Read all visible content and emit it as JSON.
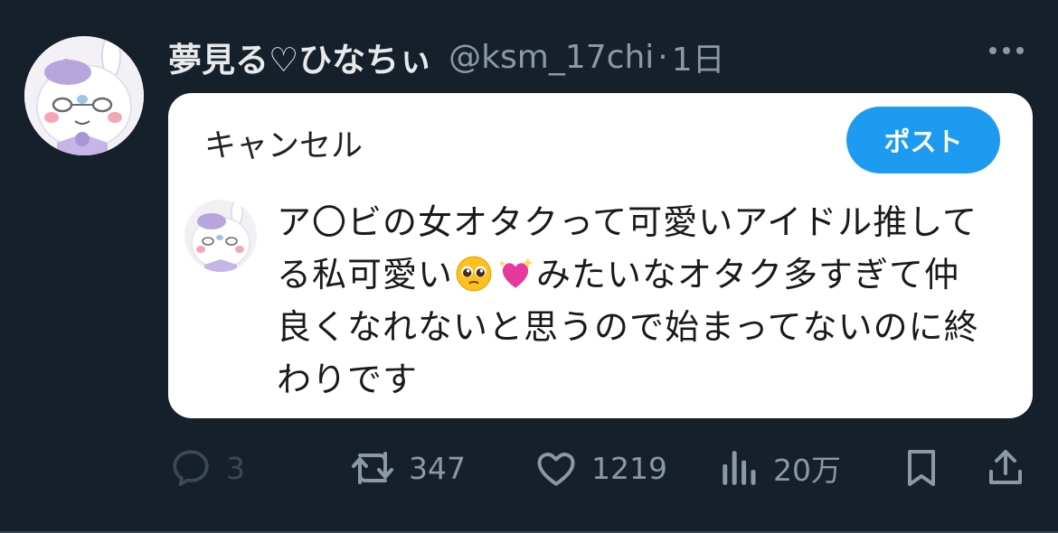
{
  "tweet": {
    "display_name": "夢見る♡ひなちぃ",
    "handle": "@ksm_17chi",
    "separator": "·",
    "time": "1日",
    "more_icon": "ellipsis-icon",
    "avatar_icon": "plush-bunny-avatar"
  },
  "card": {
    "cancel_label": "キャンセル",
    "post_label": "ポスト",
    "post_color": "#1d9bf0",
    "draft_lines": [
      "ア〇ビの女オタクって可愛いアイドル推して",
      "る私可愛い",
      "みたいなオタク多すぎて仲",
      "良くなれないと思うので始まってないのに終",
      "わりです"
    ],
    "emojis": [
      "pleading-face-emoji",
      "sparkling-heart-emoji"
    ]
  },
  "actions": {
    "reply": {
      "icon": "reply-icon",
      "count": "3"
    },
    "retweet": {
      "icon": "retweet-icon",
      "count": "347"
    },
    "like": {
      "icon": "heart-icon",
      "count": "1219"
    },
    "views": {
      "icon": "views-icon",
      "count": "20万"
    },
    "bookmark": {
      "icon": "bookmark-icon"
    },
    "share": {
      "icon": "share-icon"
    }
  },
  "colors": {
    "background": "#15202b",
    "muted": "#8b98a5",
    "text": "#e7e9ea"
  }
}
